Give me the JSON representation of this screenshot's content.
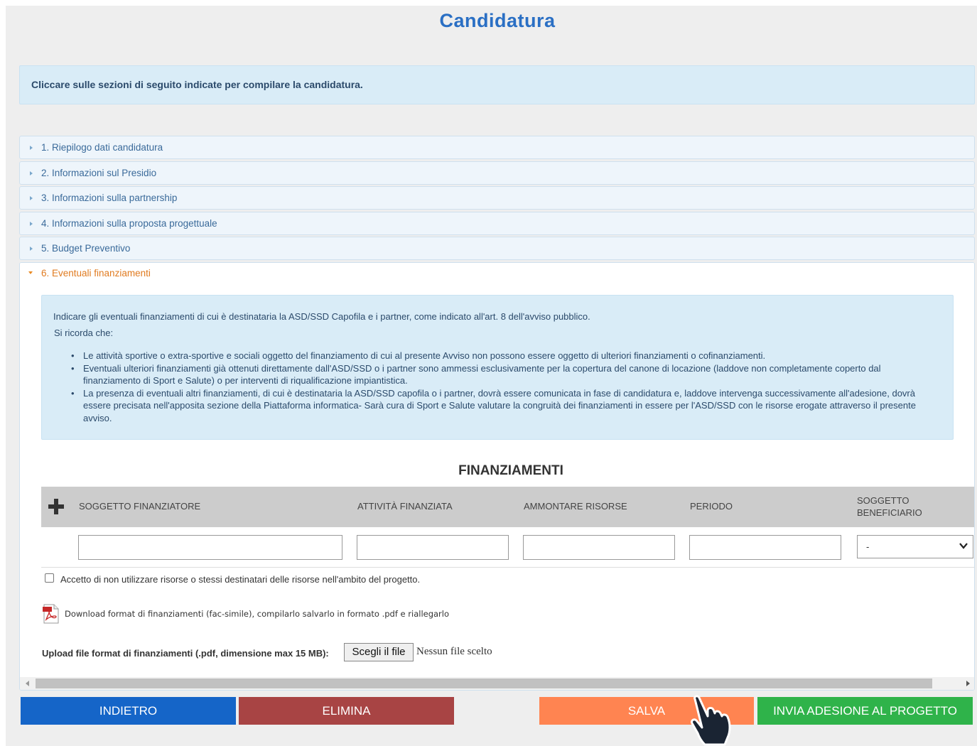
{
  "page": {
    "title": "Candidatura"
  },
  "info": {
    "text": "Cliccare sulle sezioni di seguito indicate per compilare la candidatura."
  },
  "sections": [
    {
      "label": "1. Riepilogo dati candidatura"
    },
    {
      "label": "2. Informazioni sul Presidio"
    },
    {
      "label": "3. Informazioni sulla partnership"
    },
    {
      "label": "4. Informazioni sulla proposta progettuale"
    },
    {
      "label": "5. Budget Preventivo"
    }
  ],
  "open_section": {
    "label": "6. Eventuali finanziamenti",
    "note_intro": "Indicare gli eventuali finanziamenti di cui è destinataria la ASD/SSD Capofila e i partner, come indicato all'art. 8 dell'avviso pubblico.",
    "note_reminder": "Si ricorda che:",
    "bullets": [
      "Le attività sportive o extra-sportive e sociali oggetto del finanziamento di cui al presente Avviso non possono essere oggetto di ulteriori finanziamenti o cofinanziamenti.",
      "Eventuali ulteriori finanziamenti già ottenuti direttamente dall'ASD/SSD o i partner sono ammessi esclusivamente per la copertura del canone di locazione (laddove non completamente coperto dal finanziamento di Sport e Salute) o per interventi di riqualificazione impiantistica.",
      "La presenza di eventuali altri finanziamenti, di cui è destinataria la ASD/SSD capofila o i partner, dovrà essere comunicata in fase di candidatura e, laddove intervenga successivamente all'adesione, dovrà essere precisata nell'apposita sezione della Piattaforma informatica- Sarà cura di Sport e Salute valutare la congruità dei finanziamenti in essere per l'ASD/SSD con le risorse erogate attraverso il presente avviso."
    ],
    "table_title": "FINANZIAMENTI",
    "columns": [
      "SOGGETTO FINANZIATORE",
      "ATTIVITÀ FINANZIATA",
      "AMMONTARE RISORSE",
      "PERIODO",
      "SOGGETTO BENEFICIARIO"
    ],
    "row": {
      "soggetto_finanziatore": "",
      "attivita_finanziata": "",
      "ammontare_risorse": "",
      "periodo": "",
      "soggetto_beneficiario": "-"
    },
    "checkbox_label": "Accetto di non utilizzare risorse o stessi destinatari delle risorse nell'ambito del progetto.",
    "download_text": "Download format di finanziamenti (fac-simile), compilarlo salvarlo in formato .pdf e riallegarlo",
    "upload_label": "Upload file format di finanziamenti (.pdf, dimensione max 15 MB):",
    "file_button": "Scegli il file",
    "file_status": "Nessun file scelto"
  },
  "actions": {
    "back": "INDIETRO",
    "delete": "ELIMINA",
    "save": "SALVA",
    "submit": "INVIA ADESIONE AL PROGETTO"
  },
  "colors": {
    "back": "#1565c8",
    "delete": "#a84444",
    "save": "#ff8451",
    "submit": "#2fb34a",
    "accent_open": "#e07b20",
    "title": "#2a6fc4"
  },
  "icons": {
    "plus": "plus-icon",
    "pdf": "pdf-file-icon",
    "cursor": "hand-pointer-icon",
    "dropdown": "chevron-down-icon"
  }
}
